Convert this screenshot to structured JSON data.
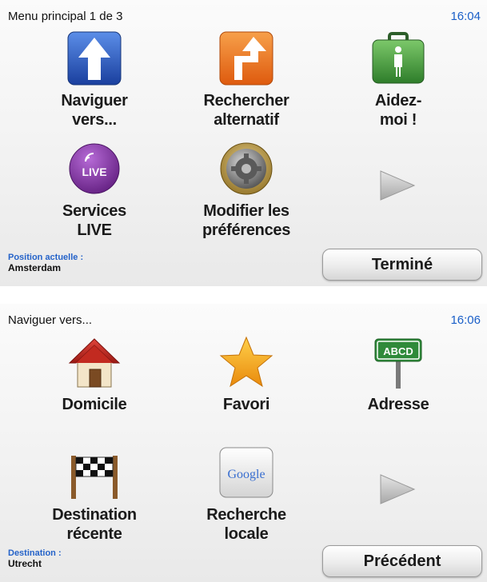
{
  "screen_main": {
    "title": "Menu principal 1 de 3",
    "time": "16:04",
    "tiles": [
      {
        "label": "Naviguer\nvers...",
        "icon": "up-arrow-icon"
      },
      {
        "label": "Rechercher\nalternatif",
        "icon": "detour-arrow-icon"
      },
      {
        "label": "Aidez-\nmoi !",
        "icon": "first-aid-kit-icon"
      },
      {
        "label": "Services\nLIVE",
        "icon": "live-services-icon",
        "badge": "LIVE"
      },
      {
        "label": "Modifier les\npréférences",
        "icon": "settings-gear-icon"
      }
    ],
    "next_icon": "next-page-arrow-icon",
    "info_label": "Position actuelle :",
    "info_value": "Amsterdam",
    "button": "Terminé"
  },
  "screen_nav": {
    "title": "Naviguer vers...",
    "time": "16:06",
    "tiles": [
      {
        "label": "Domicile",
        "icon": "home-icon"
      },
      {
        "label": "Favori",
        "icon": "star-icon"
      },
      {
        "label": "Adresse",
        "icon": "street-sign-icon",
        "sign_text": "ABCD"
      },
      {
        "label": "Destination\nrécente",
        "icon": "checkered-flag-icon"
      },
      {
        "label": "Recherche\nlocale",
        "icon": "google-search-icon",
        "logo_text": "Google"
      }
    ],
    "next_icon": "next-page-arrow-icon",
    "info_label": "Destination :",
    "info_value": "Utrecht",
    "button": "Précédent"
  },
  "colors": {
    "clock": "#1a5fc8",
    "info_label": "#2563c9",
    "navigate_blue": "#1f4fb8",
    "detour_orange": "#ee7a1c",
    "help_green": "#3e9a3a",
    "live_purple": "#7b2d9a",
    "star_gold": "#f5a51b"
  }
}
